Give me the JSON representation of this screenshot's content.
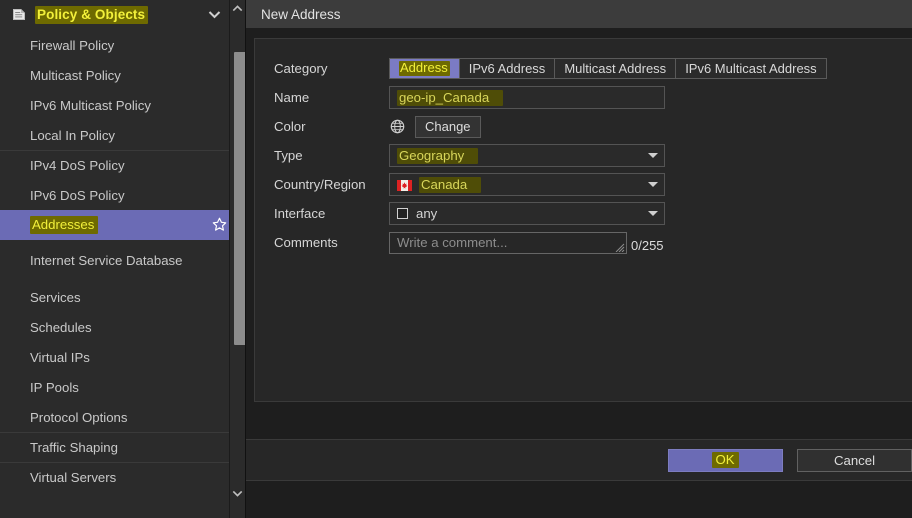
{
  "sidebar": {
    "header": {
      "icon": "document-policy-icon",
      "title": "Policy & Objects",
      "chevron": "chevron-down-icon"
    },
    "items": [
      {
        "label": "Firewall Policy",
        "selected": false,
        "separator": false,
        "twoline": false,
        "star": false
      },
      {
        "label": "Multicast Policy",
        "selected": false,
        "separator": false,
        "twoline": false,
        "star": false
      },
      {
        "label": "IPv6 Multicast Policy",
        "selected": false,
        "separator": false,
        "twoline": false,
        "star": false
      },
      {
        "label": "Local In Policy",
        "selected": false,
        "separator": false,
        "twoline": false,
        "star": false
      },
      {
        "label": "IPv4 DoS Policy",
        "selected": false,
        "separator": true,
        "twoline": false,
        "star": false
      },
      {
        "label": "IPv6 DoS Policy",
        "selected": false,
        "separator": false,
        "twoline": false,
        "star": false
      },
      {
        "label": "Addresses",
        "selected": true,
        "separator": false,
        "twoline": false,
        "star": true
      },
      {
        "label": "Internet Service Database",
        "selected": false,
        "separator": false,
        "twoline": true,
        "star": false
      },
      {
        "label": "Services",
        "selected": false,
        "separator": false,
        "twoline": false,
        "star": false
      },
      {
        "label": "Schedules",
        "selected": false,
        "separator": false,
        "twoline": false,
        "star": false
      },
      {
        "label": "Virtual IPs",
        "selected": false,
        "separator": false,
        "twoline": false,
        "star": false
      },
      {
        "label": "IP Pools",
        "selected": false,
        "separator": false,
        "twoline": false,
        "star": false
      },
      {
        "label": "Protocol Options",
        "selected": false,
        "separator": false,
        "twoline": false,
        "star": false
      },
      {
        "label": "Traffic Shaping",
        "selected": false,
        "separator": true,
        "twoline": false,
        "star": false
      },
      {
        "label": "Virtual Servers",
        "selected": false,
        "separator": true,
        "twoline": false,
        "star": false
      }
    ],
    "scrollbar": {
      "up_arrow": "chevron-up-icon",
      "down_arrow": "chevron-down-icon"
    }
  },
  "dialog": {
    "title": "New Address",
    "fields": {
      "category": {
        "label": "Category",
        "options": [
          "Address",
          "IPv6 Address",
          "Multicast Address",
          "IPv6 Multicast Address"
        ],
        "selected": "Address"
      },
      "name": {
        "label": "Name",
        "value": "geo-ip_Canada"
      },
      "color": {
        "label": "Color",
        "swatch_icon": "globe-color-icon",
        "button_label": "Change"
      },
      "type": {
        "label": "Type",
        "value": "Geography"
      },
      "country": {
        "label": "Country/Region",
        "value": "Canada",
        "flag_icon": "flag-canada-icon"
      },
      "interface": {
        "label": "Interface",
        "value": "any",
        "icon": "checkbox-icon"
      },
      "comments": {
        "label": "Comments",
        "placeholder": "Write a comment...",
        "value": "",
        "counter": "0/255"
      }
    },
    "footer": {
      "ok_label": "OK",
      "cancel_label": "Cancel"
    }
  },
  "colors": {
    "accent_purple": "#6b6bb5",
    "highlight_yellow": "#f2f03a",
    "highlight_bg": "#6e6a00",
    "panel_bg": "#272727",
    "sidebar_bg": "#2b2b2b",
    "titlebar_bg": "#3c3c3c"
  }
}
